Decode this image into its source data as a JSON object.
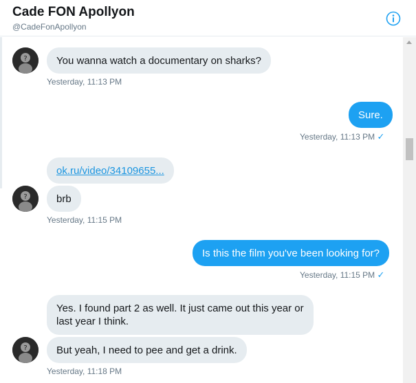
{
  "header": {
    "name": "Cade FON Apollyon",
    "handle": "@CadeFonApollyon",
    "info_icon": "info-icon"
  },
  "colors": {
    "accent": "#1da1f2",
    "incoming_bubble": "#e6ecf0",
    "timestamp": "#657786",
    "link": "#1b95e0"
  },
  "messages": [
    {
      "direction": "in",
      "text": "You wanna watch a documentary on sharks?",
      "time": "Yesterday, 11:13 PM"
    },
    {
      "direction": "out",
      "text": "Sure.",
      "time": "Yesterday, 11:13 PM",
      "read_icon": "checkmark-icon",
      "read_mark": "✓"
    },
    {
      "direction": "in",
      "link": "ok.ru/video/34109655...",
      "text": "brb",
      "time": "Yesterday, 11:15 PM"
    },
    {
      "direction": "out",
      "text": "Is this the film you've been looking for?",
      "time": "Yesterday, 11:15 PM",
      "read_icon": "checkmark-icon",
      "read_mark": "✓"
    },
    {
      "direction": "in",
      "text_line1": "Yes. I found part 2 as well. It just came out this year or",
      "text_line2": "last year I think.",
      "text2": "But yeah, I need to pee and get a drink.",
      "time": "Yesterday, 11:18 PM"
    }
  ]
}
